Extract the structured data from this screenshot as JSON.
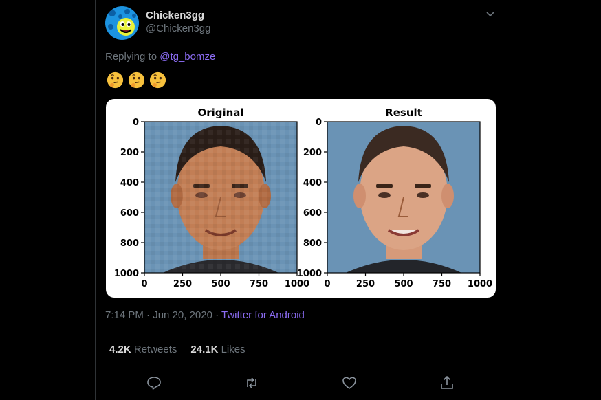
{
  "tweet": {
    "display_name": "Chicken3gg",
    "handle": "@Chicken3gg",
    "replying_prefix": "Replying to",
    "replying_to": "@tg_bomze",
    "emoji_count": 3,
    "timestamp": "7:14 PM · Jun 20, 2020 · ",
    "source": "Twitter for Android",
    "retweets_count": "4.2K",
    "retweets_label": "Retweets",
    "likes_count": "24.1K",
    "likes_label": "Likes"
  },
  "icons": {
    "caret": "chevron-down-icon",
    "reply": "comment-icon",
    "retweet": "retweet-icon",
    "like": "heart-icon",
    "share": "share-icon"
  },
  "colors": {
    "background": "#000000",
    "text": "#d9d9d9",
    "muted": "#6e767d",
    "link": "#8b6cf2",
    "border": "#2f3336"
  },
  "chart_data": [
    {
      "type": "image",
      "title": "Original",
      "x_ticks": [
        0,
        250,
        500,
        750,
        1000
      ],
      "y_ticks": [
        0,
        200,
        400,
        600,
        800,
        1000
      ],
      "xlim": [
        0,
        1000
      ],
      "ylim": [
        1000,
        0
      ]
    },
    {
      "type": "image",
      "title": "Result",
      "x_ticks": [
        0,
        250,
        500,
        750,
        1000
      ],
      "y_ticks": [
        0,
        200,
        400,
        600,
        800,
        1000
      ],
      "xlim": [
        0,
        1000
      ],
      "ylim": [
        1000,
        0
      ]
    }
  ]
}
